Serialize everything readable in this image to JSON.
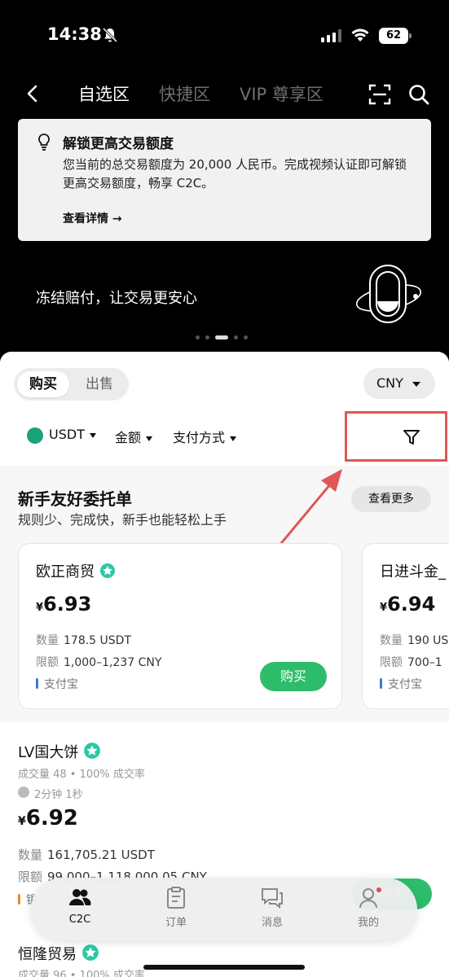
{
  "status_bar": {
    "time": "14:38",
    "battery": "62"
  },
  "nav": {
    "tabs": [
      {
        "label": "自选区",
        "active": true
      },
      {
        "label": "快捷区",
        "active": false
      },
      {
        "label": "VIP 尊享区",
        "active": false
      }
    ]
  },
  "notice": {
    "title": "解锁更高交易额度",
    "description": "您当前的总交易额度为 20,000 人民币。完成视频认证即可解锁更高交易额度，畅享 C2C。",
    "link": "查看详情 →"
  },
  "promo": {
    "text": "冻结赔付，让交易更安心"
  },
  "trade": {
    "buy_label": "购买",
    "sell_label": "出售",
    "currency": "CNY",
    "filters": {
      "coin": "USDT",
      "amount": "金额",
      "payment": "支付方式"
    }
  },
  "featured": {
    "title": "新手友好委托单",
    "subtitle": "规则少、完成快，新手也能轻松上手",
    "more": "查看更多",
    "cards": [
      {
        "name": "欧正商贸",
        "currency_symbol": "¥",
        "price": "6.93",
        "qty_label": "数量",
        "qty": "178.5 USDT",
        "limit_label": "限额",
        "limit": "1,000–1,237 CNY",
        "payment": "支付宝",
        "buy": "购买"
      },
      {
        "name": "日进斗金_",
        "currency_symbol": "¥",
        "price": "6.94",
        "qty_label": "数量",
        "qty": "190 US",
        "limit_label": "限额",
        "limit": "700–1",
        "payment": "支付宝"
      }
    ]
  },
  "listings": [
    {
      "name": "LV国大饼",
      "stats": "成交量 48 • 100% 成交率",
      "time": "2分钟 1秒",
      "currency_symbol": "¥",
      "price": "6.92",
      "qty_label": "数量",
      "qty": "161,705.21 USDT",
      "limit_label": "限额",
      "limit": "99,000–1,118,000.05 CNY",
      "payment": "银",
      "buy": "购买"
    },
    {
      "name": "恒隆贸易",
      "stats": "成交量 96 • 100% 成交率"
    }
  ],
  "tabbar": {
    "items": [
      {
        "label": "C2C",
        "active": true
      },
      {
        "label": "订单",
        "active": false
      },
      {
        "label": "消息",
        "active": false
      },
      {
        "label": "我的",
        "active": false
      }
    ]
  },
  "colors": {
    "accent_green": "#2dbd6a",
    "highlight_red": "#e05757",
    "background": "#000000"
  }
}
